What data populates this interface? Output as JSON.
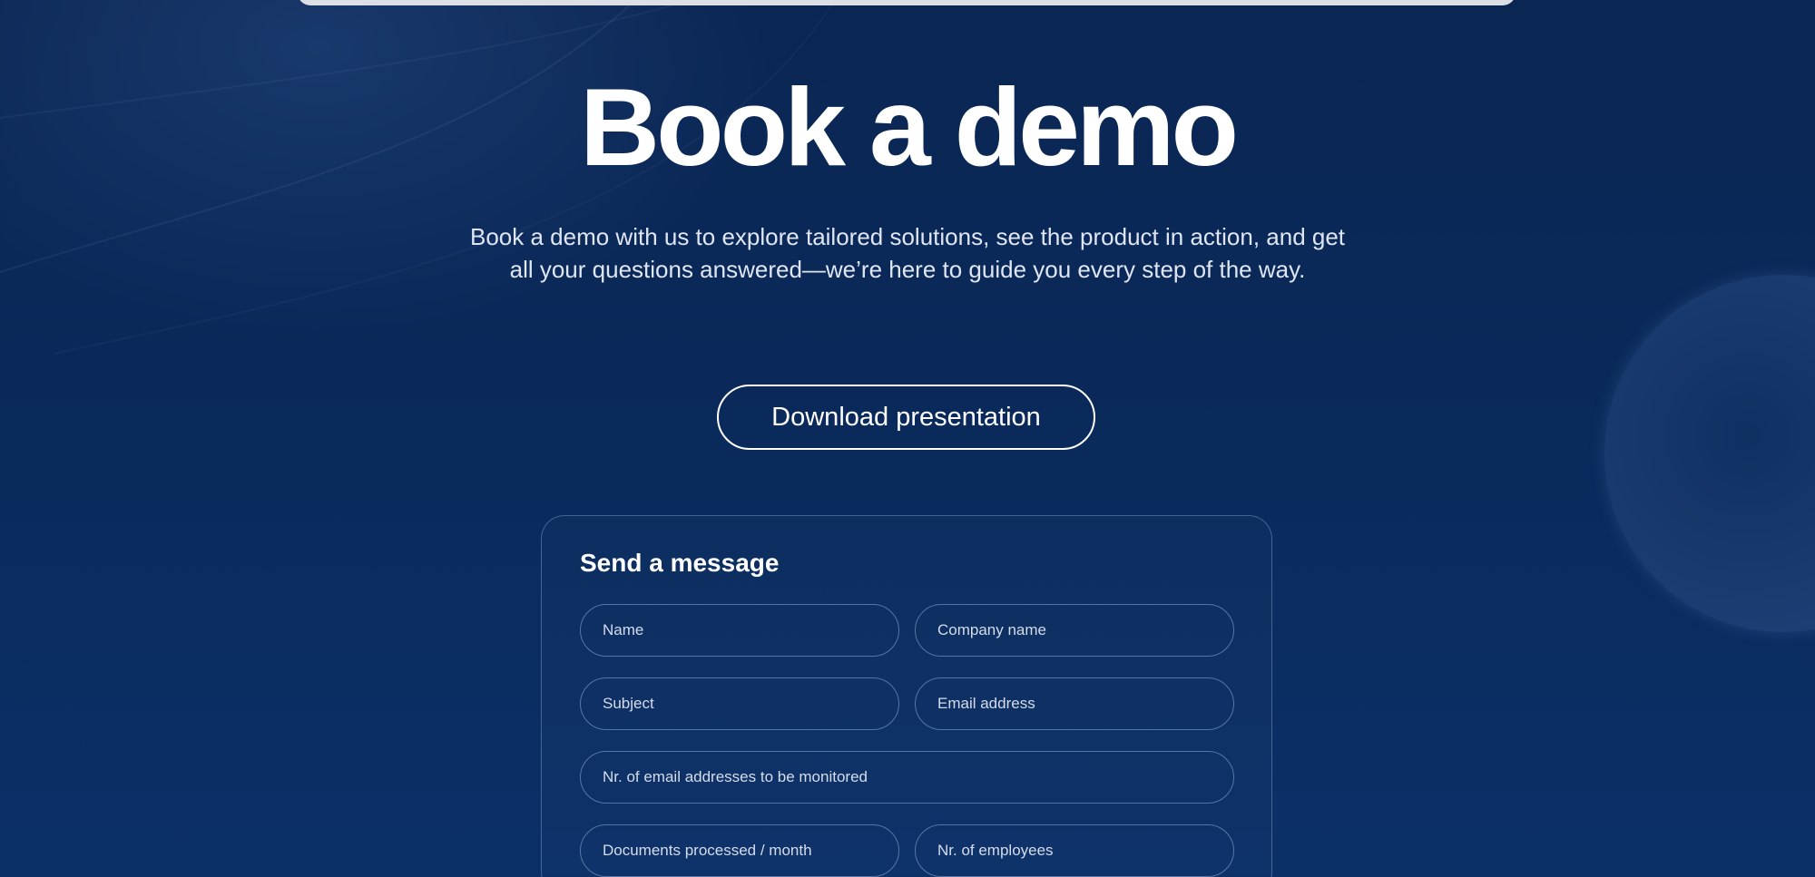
{
  "hero": {
    "title": "Book a demo",
    "subtitle": "Book a demo with us to explore tailored solutions, see the product in action, and get all your questions answered—we’re here to guide you every step of the way.",
    "download_label": "Download presentation"
  },
  "form": {
    "title": "Send a message",
    "fields": {
      "name": {
        "placeholder": "Name",
        "value": ""
      },
      "company_name": {
        "placeholder": "Company name",
        "value": ""
      },
      "subject": {
        "placeholder": "Subject",
        "value": ""
      },
      "email_address": {
        "placeholder": "Email address",
        "value": ""
      },
      "email_count": {
        "placeholder": "Nr. of email addresses to be monitored",
        "value": ""
      },
      "documents_per_month": {
        "placeholder": "Documents processed / month",
        "value": ""
      },
      "employees": {
        "placeholder": "Nr. of employees",
        "value": ""
      }
    }
  },
  "colors": {
    "background_top": "#0a2653",
    "background_bottom": "#0b3068",
    "text_primary": "#ffffff",
    "text_secondary": "#dfe6f2",
    "field_border": "#96afd7"
  }
}
